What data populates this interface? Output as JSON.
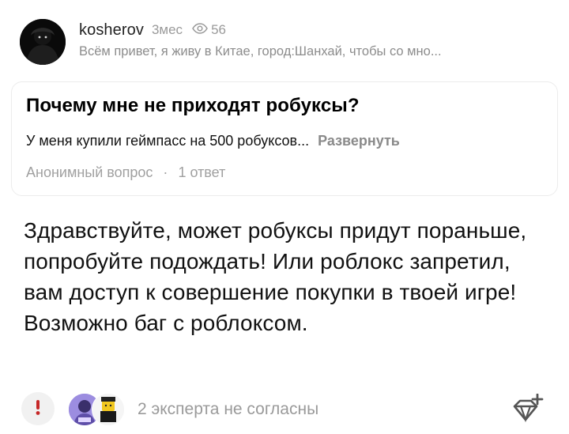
{
  "post": {
    "author": "kosherov",
    "age": "3мес",
    "views": "56",
    "bio": "Всём привет, я живу в Китае, город:Шанхай, чтобы со мно..."
  },
  "question": {
    "title": "Почему мне не приходят робуксы?",
    "excerpt": "У меня купили геймпасс на 500 робуксов...",
    "expand_label": "Развернуть",
    "author_label": "Анонимный вопрос",
    "separator": "·",
    "answers_count": "1 ответ"
  },
  "answer": {
    "text": "Здравствуйте, может робуксы придут пораньше, попробуйте подождать! Или роблокс запретил, вам доступ к совершение покупки в твоей игре! Возможно баг с роблоксом."
  },
  "footer": {
    "disagree_icon": "exclamation-icon",
    "experts_disagree": "2 эксперта не согласны",
    "diamond_icon": "diamond-plus-icon"
  },
  "colors": {
    "muted_text": "#9a9a9a",
    "card_border": "#ececec",
    "expand_text": "#8a8a8a",
    "disagree_icon": "#c62828"
  }
}
